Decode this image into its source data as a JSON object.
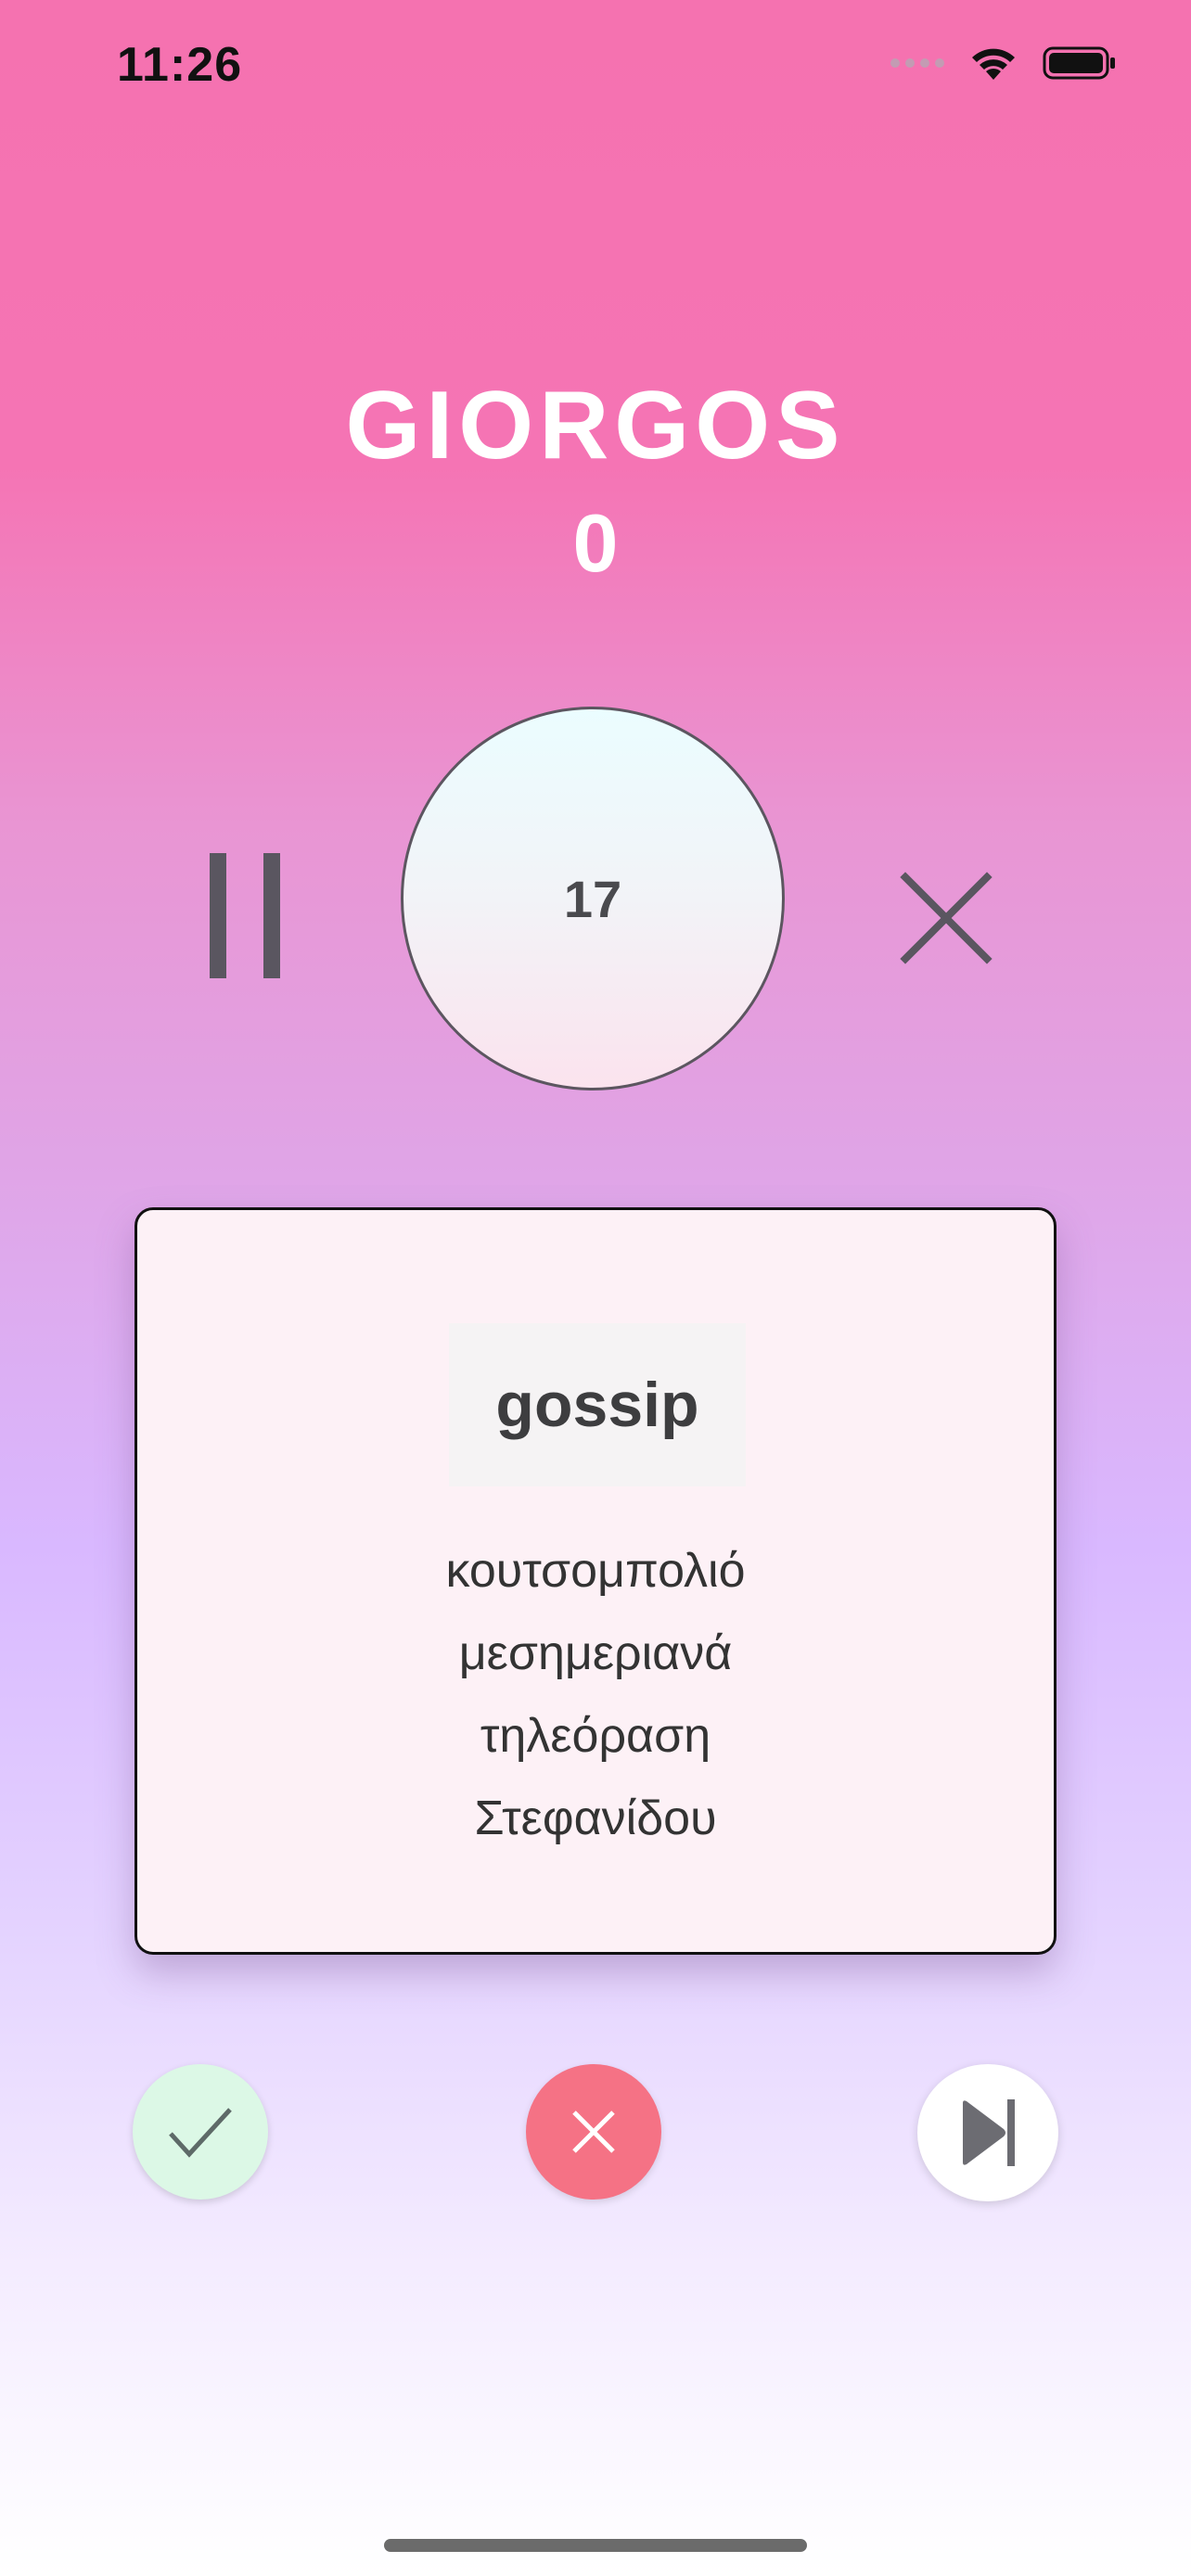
{
  "status_bar": {
    "time": "11:26",
    "icons": [
      "signal-icon",
      "wifi-icon",
      "battery-icon"
    ]
  },
  "player": {
    "name": "GIORGOS",
    "score": "0"
  },
  "timer": {
    "value": "17"
  },
  "controls": {
    "pause_icon": "pause-icon",
    "close_icon": "close-icon"
  },
  "card": {
    "word": "gossip",
    "taboo_words": [
      "κουτσομπολιό",
      "μεσημεριανά",
      "τηλεόραση",
      "Στεφανίδου"
    ]
  },
  "actions": {
    "correct_icon": "checkmark-icon",
    "wrong_icon": "x-icon",
    "skip_icon": "skip-forward-icon"
  },
  "colors": {
    "gradient_top": "#f572b0",
    "gradient_mid": "#d9b8ff",
    "gradient_bottom": "#ffffff",
    "correct_bg": "#dcf8e6",
    "wrong_bg": "#f57285",
    "icon_gray": "#5a5660"
  }
}
